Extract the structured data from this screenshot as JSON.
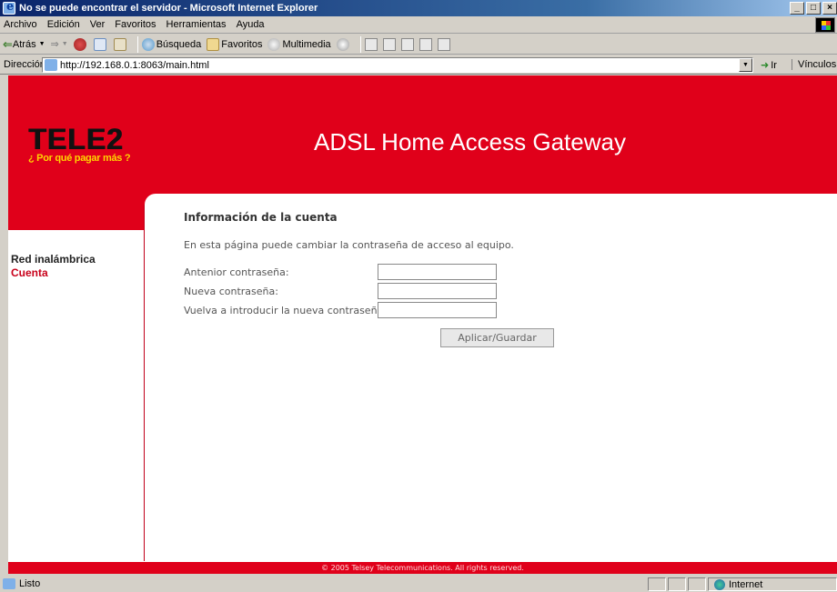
{
  "window": {
    "title": "No se puede encontrar el servidor - Microsoft Internet Explorer",
    "controls": [
      "_",
      "□",
      "×"
    ]
  },
  "menu": [
    {
      "label": "Archivo"
    },
    {
      "label": "Edición"
    },
    {
      "label": "Ver"
    },
    {
      "label": "Favoritos"
    },
    {
      "label": "Herramientas"
    },
    {
      "label": "Ayuda"
    }
  ],
  "toolbar": {
    "back_label": "Atrás",
    "search_label": "Búsqueda",
    "favorites_label": "Favoritos",
    "media_label": "Multimedia"
  },
  "address": {
    "label": "Dirección",
    "url": "http://192.168.0.1:8063/main.html",
    "go_label": "Ir",
    "links_label": "Vínculos"
  },
  "banner": {
    "logo_text": "TELE2",
    "logo_tagline": "¿ Por qué pagar más ?",
    "title": "ADSL Home Access Gateway"
  },
  "nav": [
    {
      "label": "Red inalámbrica",
      "active": false
    },
    {
      "label": "Cuenta",
      "active": true
    }
  ],
  "account": {
    "title": "Información de la cuenta",
    "description": "En esta página puede cambiar la contraseña de acceso al equipo.",
    "old_password_label": "Antenior contraseña:",
    "new_password_label": "Nueva contraseña:",
    "confirm_password_label": "Vuelva a introducir la nueva contraseña:",
    "apply_label": "Aplicar/Guardar"
  },
  "footer": {
    "copyright": "© 2005 Telsey Telecommunications. All rights reserved."
  },
  "status": {
    "text": "Listo",
    "zone": "Internet"
  },
  "colors": {
    "brand_red": "#e0001a",
    "logo_yellow": "#ffd400"
  }
}
